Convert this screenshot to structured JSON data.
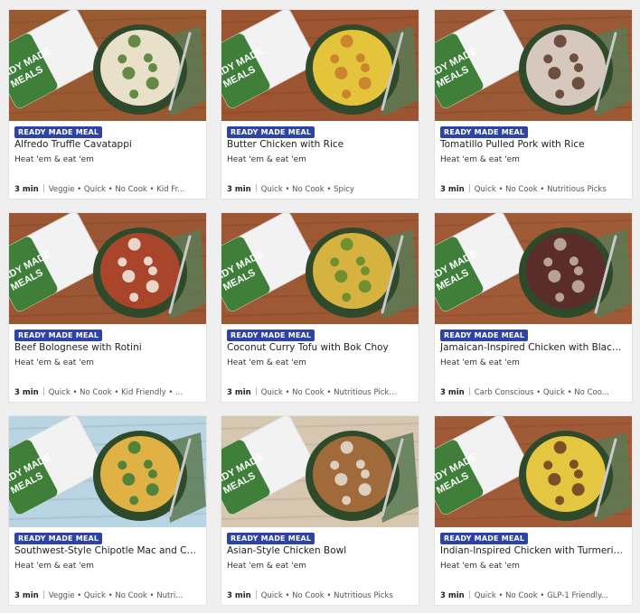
{
  "cards": [
    {
      "badge": "READY MADE MEAL",
      "title": "Alfredo Truffle Cavatappi",
      "subtitle": "Heat 'em & eat 'em",
      "time": "3 min",
      "tags": "Veggie • Quick • No Cook • Kid Fr...",
      "bg": "#9a5a31",
      "food": "#e8e0c8",
      "accent": "#4d7a2e",
      "image_text": "READY MADE MEALS"
    },
    {
      "badge": "READY MADE MEAL",
      "title": "Butter Chicken with Rice",
      "subtitle": "Heat 'em & eat 'em",
      "time": "3 min",
      "tags": "Quick • No Cook • Spicy",
      "bg": "#9c5530",
      "food": "#e3c43a",
      "accent": "#c87a2e",
      "image_text": "READY MADE MEALS"
    },
    {
      "badge": "READY MADE MEAL",
      "title": "Tomatillo Pulled Pork with Rice",
      "subtitle": "Heat 'em & eat 'em",
      "time": "3 min",
      "tags": "Quick • No Cook • Nutritious Picks",
      "bg": "#9b5a35",
      "food": "#d7c8bd",
      "accent": "#5a3a2a",
      "image_text": "READY MADE MEALS"
    },
    {
      "badge": "READY MADE MEAL",
      "title": "Beef Bolognese with Rotini",
      "subtitle": "Heat 'em & eat 'em",
      "time": "3 min",
      "tags": "Quick • No Cook • Kid Friendly • ...",
      "bg": "#9b5633",
      "food": "#a8452a",
      "accent": "#f4f0e6",
      "image_text": "READY MADE MEALS"
    },
    {
      "badge": "READY MADE MEAL",
      "title": "Coconut Curry Tofu with Bok Choy",
      "subtitle": "Heat 'em & eat 'em",
      "time": "3 min",
      "tags": "Quick • No Cook • Nutritious Pick...",
      "bg": "#9e5834",
      "food": "#d6b240",
      "accent": "#5e8a2e",
      "image_text": "READY MADE MEALS"
    },
    {
      "badge": "READY MADE MEAL",
      "title": "Jamaican-Inspired Chicken with Black Beans",
      "subtitle": "Heat 'em & eat 'em",
      "time": "3 min",
      "tags": "Carb Conscious • Quick • No Coo...",
      "bg": "#a05a36",
      "food": "#5a2c2a",
      "accent": "#c8b8a8",
      "image_text": "READY MADE MEALS"
    },
    {
      "badge": "READY MADE MEAL",
      "title": "Southwest-Style Chipotle Mac and Cheese",
      "subtitle": "Heat 'em & eat 'em",
      "time": "3 min",
      "tags": "Veggie • Quick • No Cook • Nutri...",
      "bg": "#b9d4e3",
      "food": "#e0b245",
      "accent": "#3a7a3a",
      "image_text": "READY MADE MEALS"
    },
    {
      "badge": "READY MADE MEAL",
      "title": "Asian-Style Chicken Bowl",
      "subtitle": "Heat 'em & eat 'em",
      "time": "3 min",
      "tags": "Quick • No Cook • Nutritious Picks",
      "bg": "#d7c7b1",
      "food": "#a06a3a",
      "accent": "#e8e0d8",
      "image_text": "READY MADE MEALS"
    },
    {
      "badge": "READY MADE MEAL",
      "title": "Indian-Inspired Chicken with Turmeric Rice",
      "subtitle": "Heat 'em & eat 'em",
      "time": "3 min",
      "tags": "Quick • No Cook • GLP-1 Friendly...",
      "bg": "#a05a36",
      "food": "#e4c640",
      "accent": "#6a3a22",
      "image_text": "READY MADE MEALS"
    }
  ]
}
